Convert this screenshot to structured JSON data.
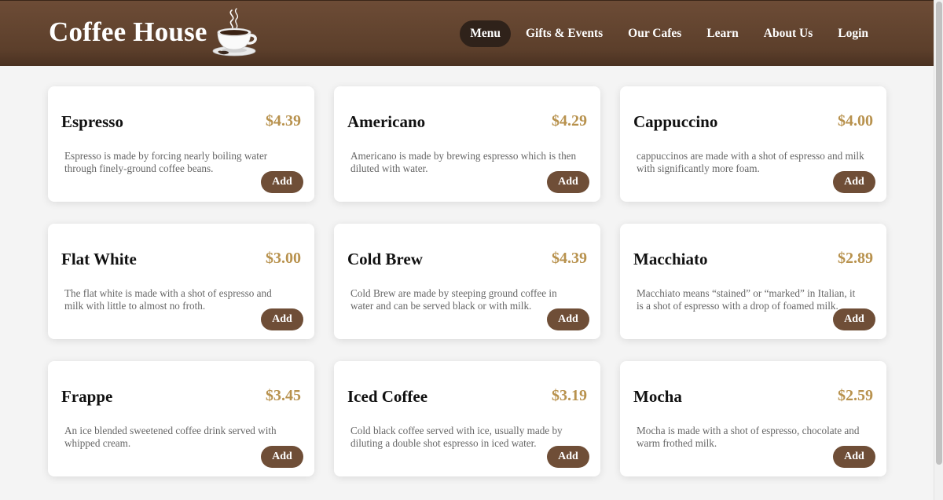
{
  "header": {
    "brand": "Coffee House",
    "brand_icon": "coffee-cup-icon",
    "nav": [
      {
        "label": "Menu",
        "active": true
      },
      {
        "label": "Gifts & Events",
        "active": false
      },
      {
        "label": "Our Cafes",
        "active": false
      },
      {
        "label": "Learn",
        "active": false
      },
      {
        "label": "About Us",
        "active": false
      },
      {
        "label": "Login",
        "active": false
      }
    ]
  },
  "menu": {
    "add_label": "Add",
    "items": [
      {
        "name": "Espresso",
        "price": "$4.39",
        "description": "Espresso is made by forcing nearly boiling water through finely-ground coffee beans."
      },
      {
        "name": "Americano",
        "price": "$4.29",
        "description": "Americano is made by brewing espresso which is then diluted with water."
      },
      {
        "name": "Cappuccino",
        "price": "$4.00",
        "description": "cappuccinos are made with a shot of espresso and milk with significantly more foam."
      },
      {
        "name": "Flat White",
        "price": "$3.00",
        "description": "The flat white is made with a shot of espresso and milk with little to almost no froth."
      },
      {
        "name": "Cold Brew",
        "price": "$4.39",
        "description": "Cold Brew are made by steeping ground coffee in water and can be served black or with milk."
      },
      {
        "name": "Macchiato",
        "price": "$2.89",
        "description": "Macchiato means “stained” or “marked” in Italian, it is a shot of espresso with a drop of foamed milk."
      },
      {
        "name": "Frappe",
        "price": "$3.45",
        "description": "An ice blended sweetened coffee drink served with whipped cream."
      },
      {
        "name": "Iced Coffee",
        "price": "$3.19",
        "description": "Cold black coffee served with ice, usually made by diluting a double shot espresso in iced water."
      },
      {
        "name": "Mocha",
        "price": "$2.59",
        "description": "Mocha is made with a shot of espresso, chocolate and warm frothed milk."
      }
    ]
  },
  "colors": {
    "header_brown": "#5c3f2b",
    "nav_active": "#2f221a",
    "price_gold": "#b8924e",
    "button_brown": "#6f4e37"
  }
}
